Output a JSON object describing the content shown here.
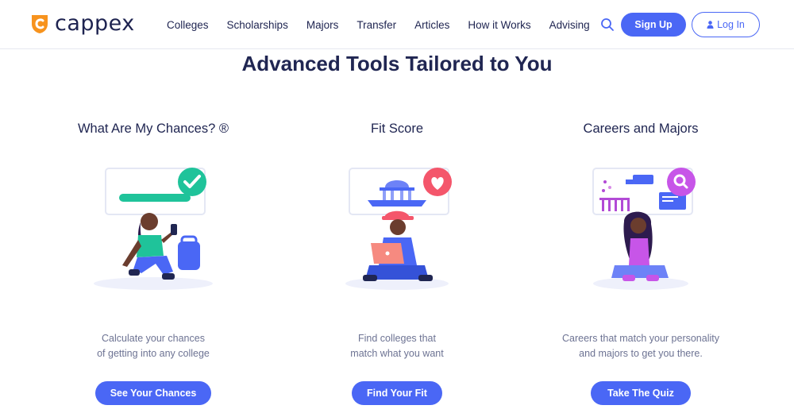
{
  "brand": {
    "name": "cappex",
    "color": "#f7931e"
  },
  "nav": {
    "items": [
      {
        "label": "Colleges"
      },
      {
        "label": "Scholarships"
      },
      {
        "label": "Majors"
      },
      {
        "label": "Transfer"
      },
      {
        "label": "Articles"
      },
      {
        "label": "How it Works"
      },
      {
        "label": "Advising"
      }
    ],
    "search_icon": "search-icon",
    "signup_label": "Sign Up",
    "login_label": "Log In"
  },
  "main": {
    "title": "Advanced Tools Tailored to You",
    "cards": [
      {
        "title": "What Are My Chances? ®",
        "desc_line1": "Calculate your chances",
        "desc_line2": "of getting into any college",
        "button": "See Your Chances",
        "icon": "checkmark-icon"
      },
      {
        "title": "Fit Score",
        "desc_line1": "Find colleges that",
        "desc_line2": "match what you want",
        "button": "Find Your Fit",
        "icon": "heart-icon"
      },
      {
        "title": "Careers and Majors",
        "desc_line1": "Careers that match your personality",
        "desc_line2": "and majors to get you there.",
        "button": "Take The Quiz",
        "icon": "magnifier-icon"
      }
    ]
  },
  "colors": {
    "accent": "#4a67f5",
    "heading": "#202652",
    "muted": "#6d7393"
  }
}
